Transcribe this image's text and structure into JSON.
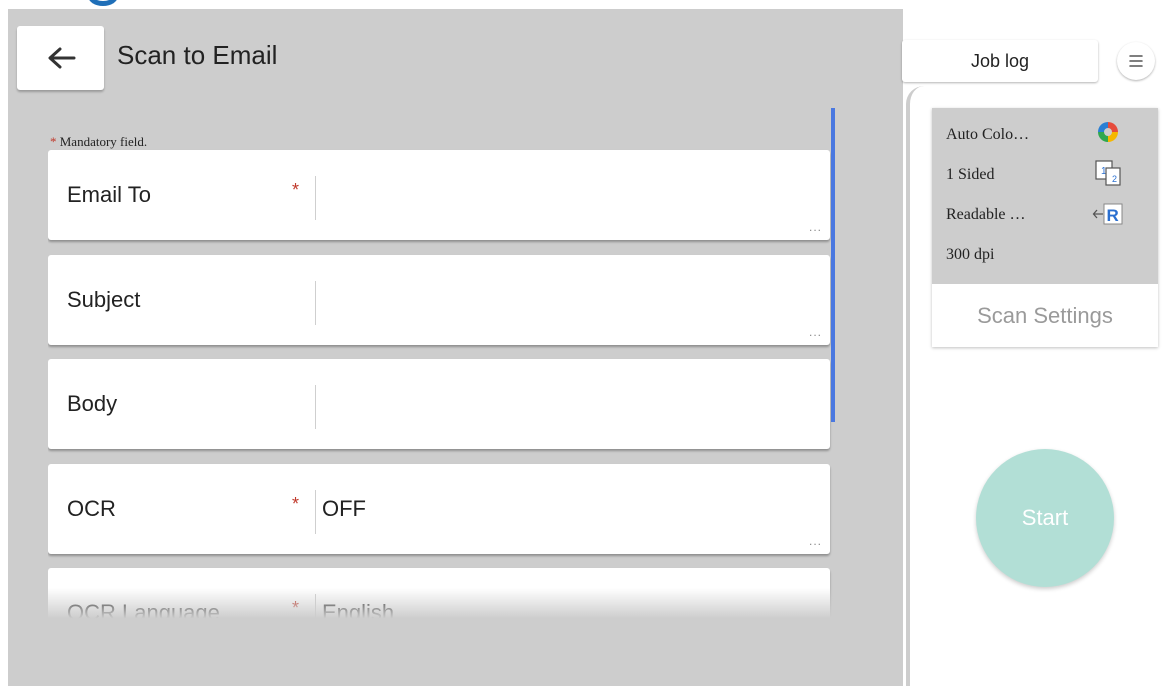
{
  "header": {
    "title": "Scan to Email",
    "back_icon": "arrow-left-icon"
  },
  "form": {
    "mandatory_asterisk": "*",
    "mandatory_note": "Mandatory field.",
    "fields": [
      {
        "label": "Email To",
        "required": "*",
        "value": "",
        "more": "..."
      },
      {
        "label": "Subject",
        "required": "",
        "value": "",
        "more": "..."
      },
      {
        "label": "Body",
        "required": "",
        "value": "",
        "more": ""
      },
      {
        "label": "OCR",
        "required": "*",
        "value": "OFF",
        "more": "..."
      },
      {
        "label": "OCR Language",
        "required": "*",
        "value": "English",
        "more": ""
      }
    ]
  },
  "toolbar": {
    "job_log_label": "Job log",
    "menu_icon": "hamburger-menu-icon"
  },
  "scan_settings": {
    "rows": [
      {
        "label": "Auto Colo…",
        "icon": "auto-color-icon"
      },
      {
        "label": "1 Sided",
        "icon": "one-sided-icon"
      },
      {
        "label": "Readable …",
        "icon": "readable-orientation-icon"
      },
      {
        "label": "300 dpi",
        "icon": ""
      }
    ],
    "button_label": "Scan Settings"
  },
  "start": {
    "label": "Start"
  },
  "colors": {
    "accent_blue": "#4a78e0",
    "required_red": "#c0392b",
    "start_teal": "#b2dfd6",
    "panel_gray": "#cdcdcd"
  }
}
